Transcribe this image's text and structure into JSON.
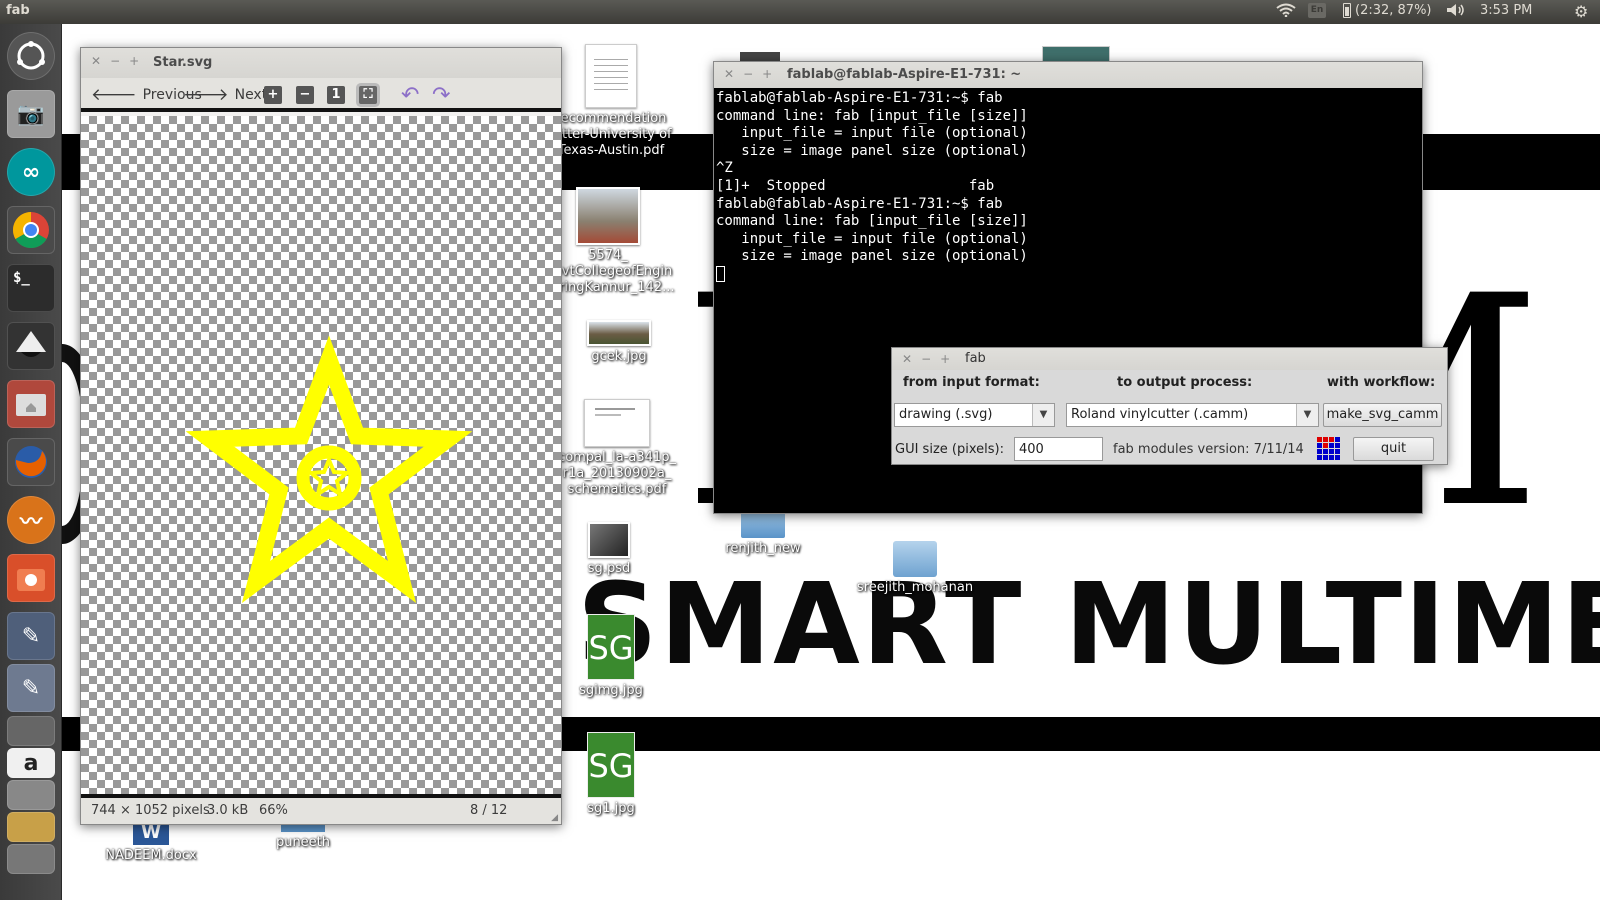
{
  "top_panel": {
    "app_title": "fab",
    "keyboard_layout": "En",
    "battery": "(2:32, 87%)",
    "time": "3:53 PM"
  },
  "desktop": {
    "background_text": "SMART MULTIMETE",
    "icons": [
      {
        "label": "recommendation\nletter-University of\nTexas-Austin.pdf"
      },
      {
        "label": "5574_\nGovtCollegeofEngin\neeringKannur_142..."
      },
      {
        "label": "gcek.jpg"
      },
      {
        "label": "compal_la-a341p_\nr1a_20130902a_\nschematics.pdf"
      },
      {
        "label": "sg.psd"
      },
      {
        "label": "sgimg.jpg",
        "badge": "SG"
      },
      {
        "label": "sg1.jpg",
        "badge": "SG"
      },
      {
        "label": "renjith_new"
      },
      {
        "label": "sreejith_mohanan"
      },
      {
        "label": "NADEEM.docx",
        "badge": "W"
      },
      {
        "label": "puneeth"
      }
    ]
  },
  "image_viewer": {
    "title": "Star.svg",
    "prev_label": "Previous",
    "next_label": "Next",
    "status": {
      "dimensions": "744 × 1052 pixels",
      "size": "3.0 kB",
      "zoom": "66%",
      "position": "8 / 12"
    }
  },
  "terminal": {
    "title": "fablab@fablab-Aspire-E1-731: ~",
    "lines": [
      "fablab@fablab-Aspire-E1-731:~$ fab",
      "command line: fab [input_file [size]]",
      "   input_file = input file (optional)",
      "   size = image panel size (optional)",
      "^Z",
      "[1]+  Stopped                 fab",
      "fablab@fablab-Aspire-E1-731:~$ fab",
      "command line: fab [input_file [size]]",
      "   input_file = input file (optional)",
      "   size = image panel size (optional)"
    ]
  },
  "fab_dialog": {
    "title": "fab",
    "input_header": "from input format:",
    "output_header": "to output process:",
    "workflow_header": "with workflow:",
    "input_format": "drawing (.svg)",
    "output_process": "Roland vinylcutter (.camm)",
    "workflow_button": "make_svg_camm",
    "gui_size_label": "GUI size (pixels):",
    "gui_size_value": "400",
    "version": "fab modules version: 7/11/14",
    "quit_label": "quit"
  }
}
